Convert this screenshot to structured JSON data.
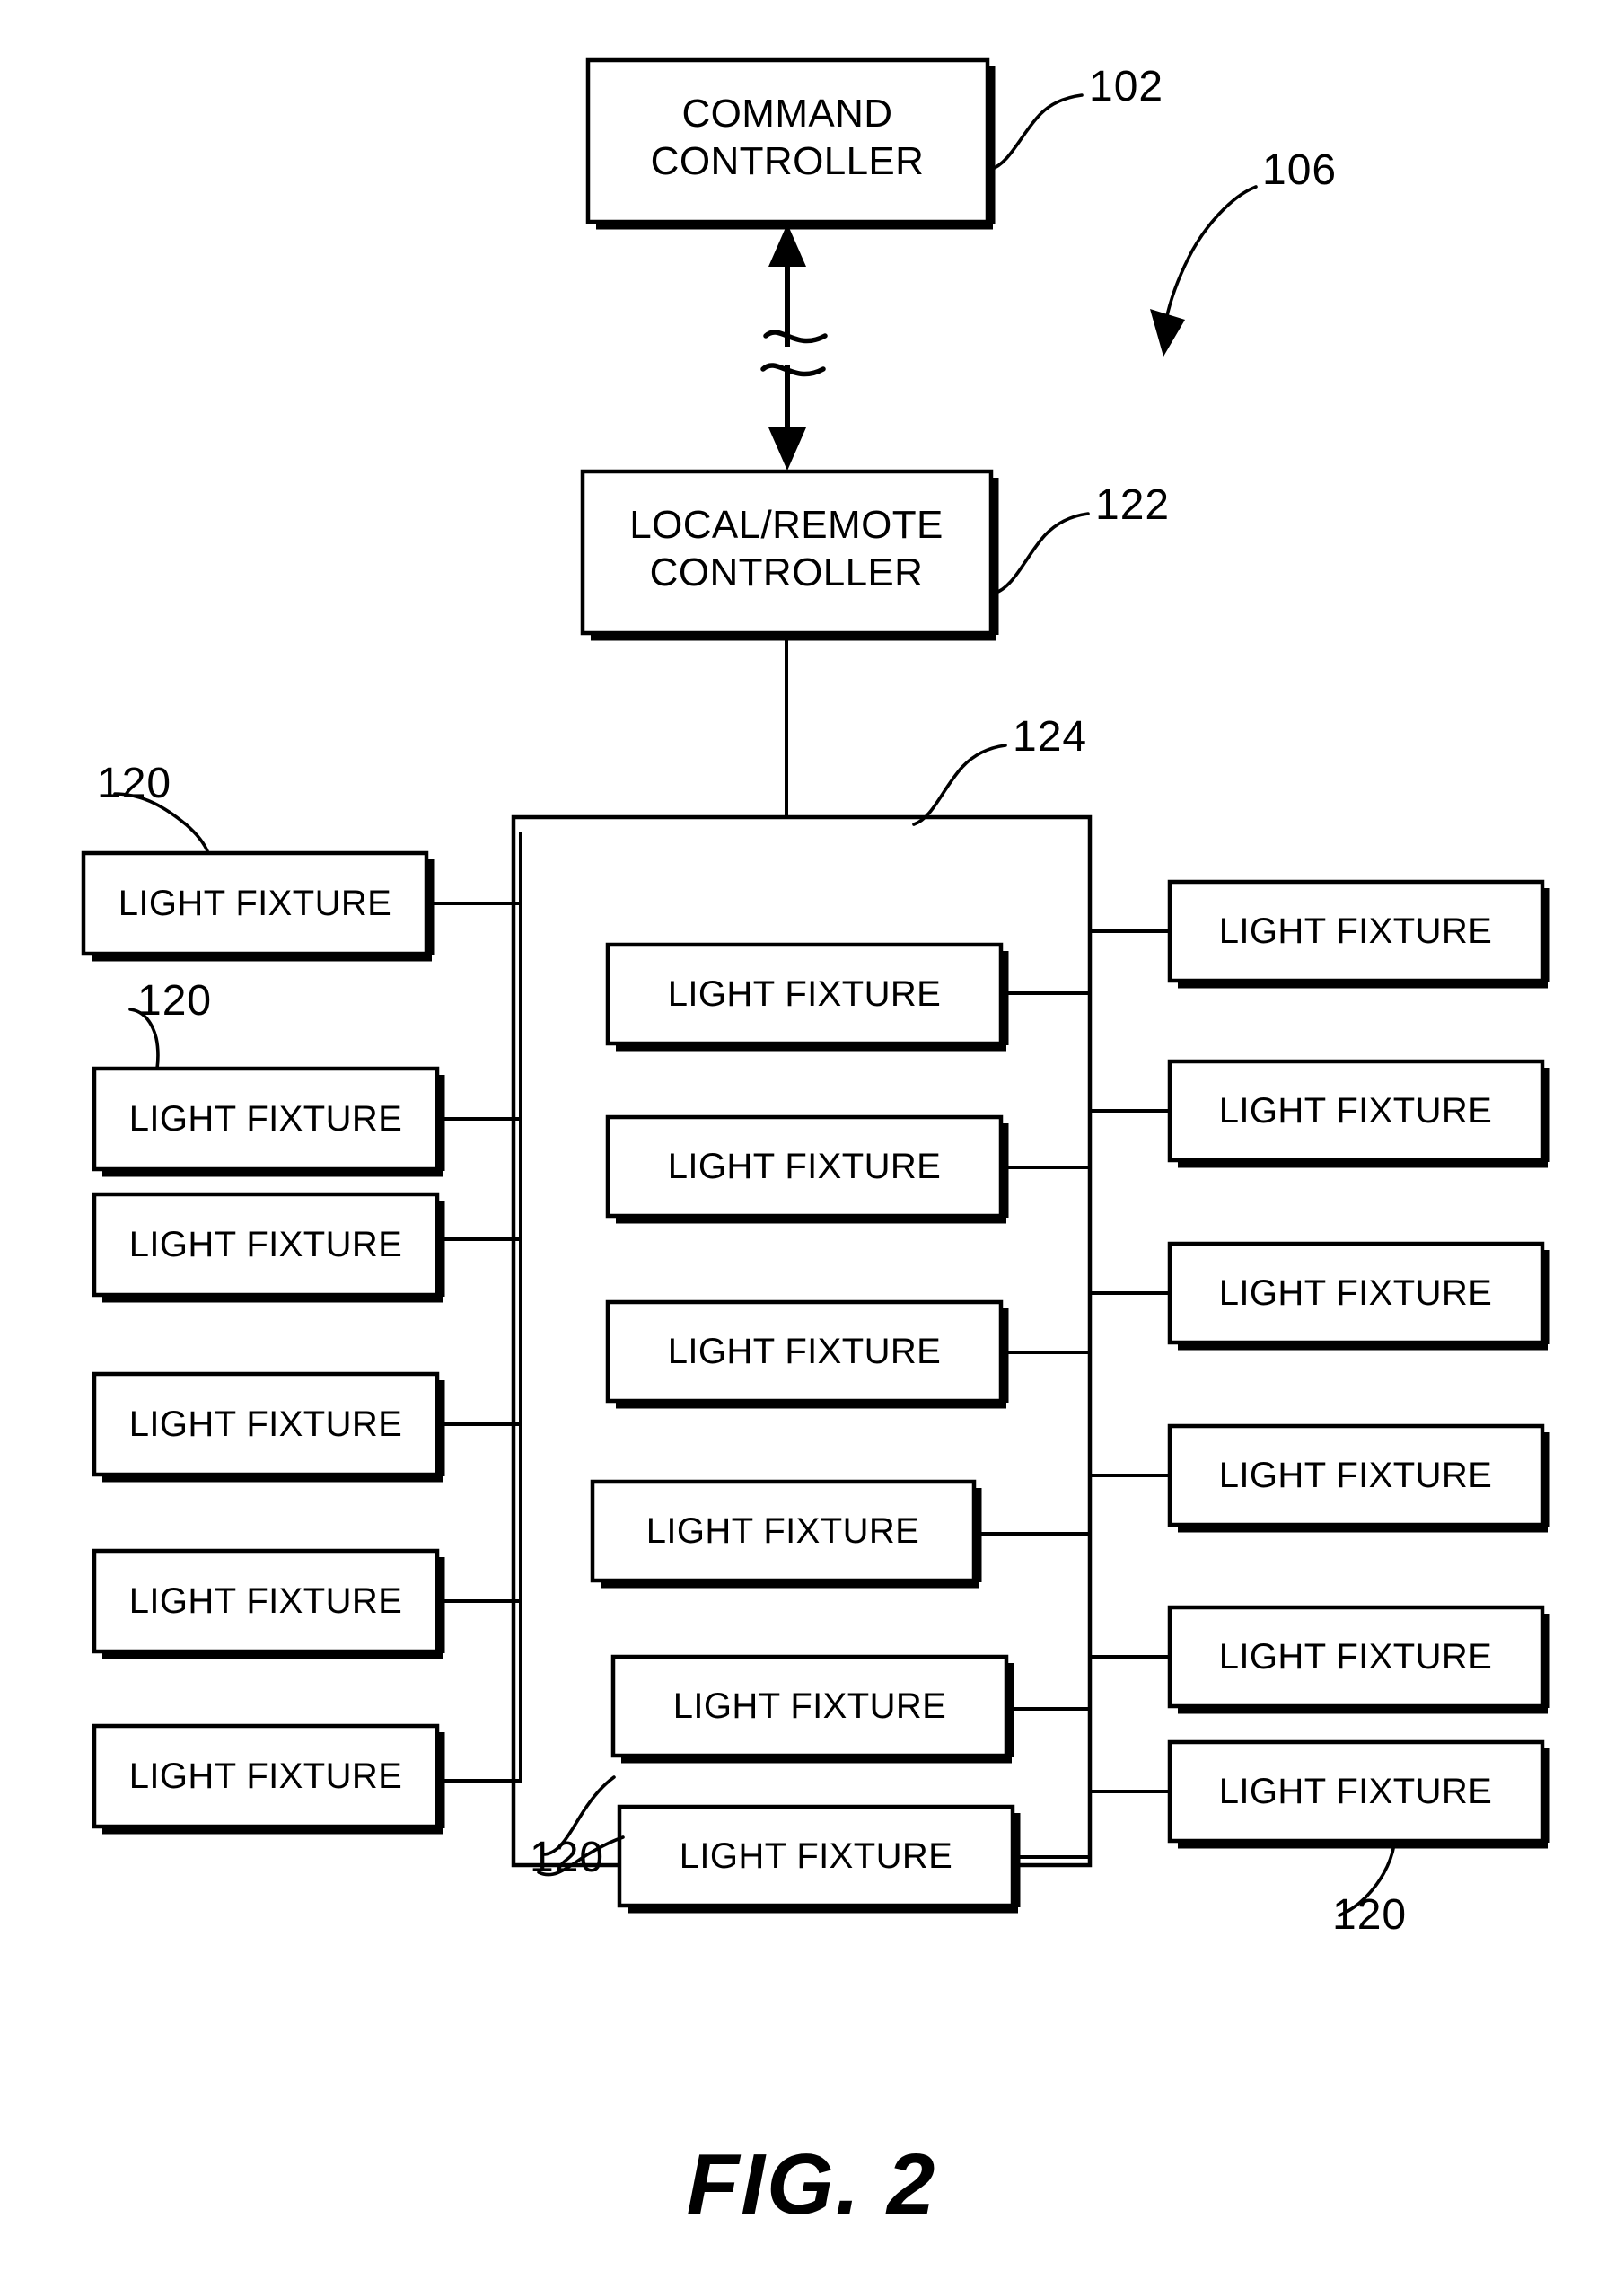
{
  "figure": {
    "caption": "FIG. 2",
    "system_ref": "106"
  },
  "nodes": {
    "command_controller": {
      "ref": "102",
      "line1": "COMMAND",
      "line2": "CONTROLLER"
    },
    "local_remote_controller": {
      "ref": "122",
      "line1": "LOCAL/REMOTE",
      "line2": "CONTROLLER"
    },
    "fixture_group": {
      "ref": "124"
    }
  },
  "fixture_label": "LIGHT FIXTURE",
  "fixture_ref": "120",
  "columns": {
    "left": {
      "name": "left-fixture-column",
      "count": 6,
      "items": [
        {
          "label": "LIGHT FIXTURE"
        },
        {
          "label": "LIGHT FIXTURE"
        },
        {
          "label": "LIGHT FIXTURE"
        },
        {
          "label": "LIGHT FIXTURE"
        },
        {
          "label": "LIGHT FIXTURE"
        },
        {
          "label": "LIGHT FIXTURE"
        }
      ]
    },
    "center": {
      "name": "center-fixture-column",
      "count": 6,
      "items": [
        {
          "label": "LIGHT FIXTURE"
        },
        {
          "label": "LIGHT FIXTURE"
        },
        {
          "label": "LIGHT FIXTURE"
        },
        {
          "label": "LIGHT FIXTURE"
        },
        {
          "label": "LIGHT FIXTURE"
        },
        {
          "label": "LIGHT FIXTURE"
        }
      ]
    },
    "right": {
      "name": "right-fixture-column",
      "count": 6,
      "items": [
        {
          "label": "LIGHT FIXTURE"
        },
        {
          "label": "LIGHT FIXTURE"
        },
        {
          "label": "LIGHT FIXTURE"
        },
        {
          "label": "LIGHT FIXTURE"
        },
        {
          "label": "LIGHT FIXTURE"
        },
        {
          "label": "LIGHT FIXTURE"
        }
      ]
    }
  },
  "ref_callouts": {
    "left_upper": "120",
    "left_second": "120",
    "center_bottom": "120",
    "right_bottom": "120"
  },
  "colors": {
    "ink": "#000000",
    "paper": "#ffffff"
  }
}
